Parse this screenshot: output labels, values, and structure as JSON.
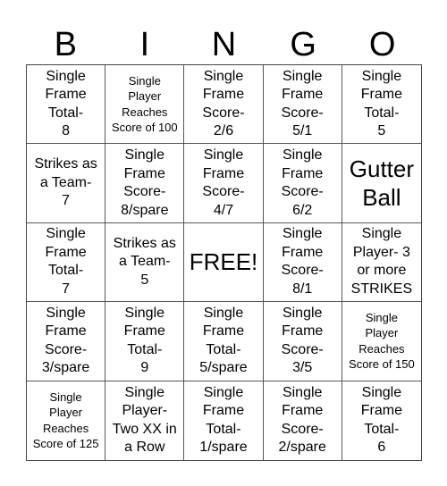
{
  "header": [
    "B",
    "I",
    "N",
    "G",
    "O"
  ],
  "cells": [
    {
      "text": "Single\nFrame\nTotal-\n8",
      "size": "normal"
    },
    {
      "text": "Single\nPlayer\nReaches\nScore of 100",
      "size": "small"
    },
    {
      "text": "Single\nFrame\nScore-\n2/6",
      "size": "normal"
    },
    {
      "text": "Single\nFrame\nScore-\n5/1",
      "size": "normal"
    },
    {
      "text": "Single\nFrame\nTotal-\n5",
      "size": "normal"
    },
    {
      "text": "Strikes as\na Team-\n7",
      "size": "normal"
    },
    {
      "text": "Single\nFrame\nScore-\n8/spare",
      "size": "normal"
    },
    {
      "text": "Single\nFrame\nScore-\n4/7",
      "size": "normal"
    },
    {
      "text": "Single\nFrame\nScore-\n6/2",
      "size": "normal"
    },
    {
      "text": "Gutter\nBall",
      "size": "large"
    },
    {
      "text": "Single\nFrame\nTotal-\n7",
      "size": "normal"
    },
    {
      "text": "Strikes as\na Team-\n5",
      "size": "normal"
    },
    {
      "text": "FREE!",
      "size": "large"
    },
    {
      "text": "Single\nFrame\nScore-\n8/1",
      "size": "normal"
    },
    {
      "text": "Single\nPlayer- 3\nor more\nSTRIKES",
      "size": "normal"
    },
    {
      "text": "Single\nFrame\nScore-\n3/spare",
      "size": "normal"
    },
    {
      "text": "Single\nFrame\nTotal-\n9",
      "size": "normal"
    },
    {
      "text": "Single\nFrame\nTotal-\n5/spare",
      "size": "normal"
    },
    {
      "text": "Single\nFrame\nScore-\n3/5",
      "size": "normal"
    },
    {
      "text": "Single\nPlayer\nReaches\nScore of 150",
      "size": "small"
    },
    {
      "text": "Single\nPlayer\nReaches\nScore of 125",
      "size": "small"
    },
    {
      "text": "Single\nPlayer-\nTwo XX in\na Row",
      "size": "normal"
    },
    {
      "text": "Single\nFrame\nTotal-\n1/spare",
      "size": "normal"
    },
    {
      "text": "Single\nFrame\nScore-\n2/spare",
      "size": "normal"
    },
    {
      "text": "Single\nFrame\nTotal-\n6",
      "size": "normal"
    }
  ]
}
